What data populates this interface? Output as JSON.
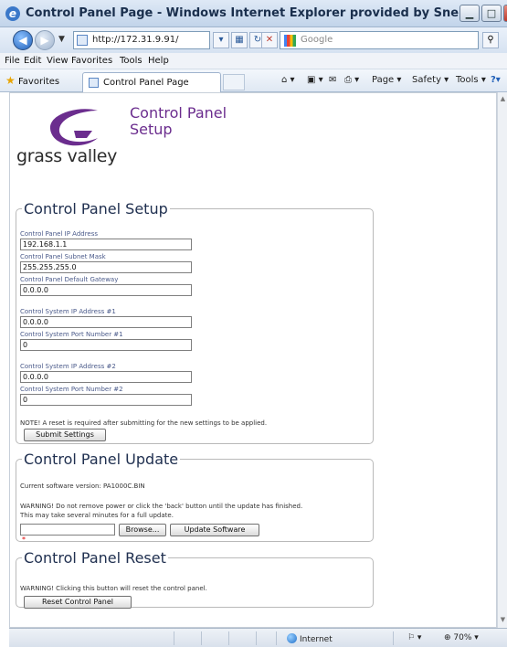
{
  "window": {
    "title": "Control Panel Page - Windows Internet Explorer provided by Snell"
  },
  "address": {
    "url": "http://172.31.9.91/",
    "search_placeholder": "Google"
  },
  "menu": [
    "File",
    "Edit",
    "View",
    "Favorites",
    "Tools",
    "Help"
  ],
  "favorites_bar": {
    "favorites_label": "Favorites",
    "tab_label": "Control Panel Page",
    "commands": [
      "Page ▾",
      "Safety ▾",
      "Tools ▾"
    ]
  },
  "header": {
    "brand": "grass valley",
    "title": "Control Panel\nSetup",
    "logo_color": "#6b2d8e"
  },
  "setup": {
    "legend": "Control Panel Setup",
    "fields": [
      {
        "label": "Control Panel IP Address",
        "value": "192.168.1.1"
      },
      {
        "label": "Control Panel Subnet Mask",
        "value": "255.255.255.0"
      },
      {
        "label": "Control Panel Default Gateway",
        "value": "0.0.0.0"
      },
      {
        "label": "Control System IP Address #1",
        "value": "0.0.0.0"
      },
      {
        "label": "Control System Port Number #1",
        "value": "0"
      },
      {
        "label": "Control System IP Address #2",
        "value": "0.0.0.0"
      },
      {
        "label": "Control System Port Number #2",
        "value": "0"
      }
    ],
    "note": "NOTE! A reset is required after submitting for the new settings to be applied.",
    "submit_label": "Submit Settings"
  },
  "update": {
    "legend": "Control Panel Update",
    "version_text": "Current software version: PA1000C.BIN",
    "warning_line1": "WARNING! Do not remove power or click the 'back' button until the update has finished.",
    "warning_line2": "This may take several minutes for a full update.",
    "browse_label": "Browse...",
    "update_label": "Update Software",
    "required_mark": "*"
  },
  "reset": {
    "legend": "Control Panel Reset",
    "warning": "WARNING! Clicking this button will reset the control panel.",
    "button_label": "Reset Control Panel"
  },
  "status": {
    "zone": "Internet",
    "zoom": "70%"
  }
}
